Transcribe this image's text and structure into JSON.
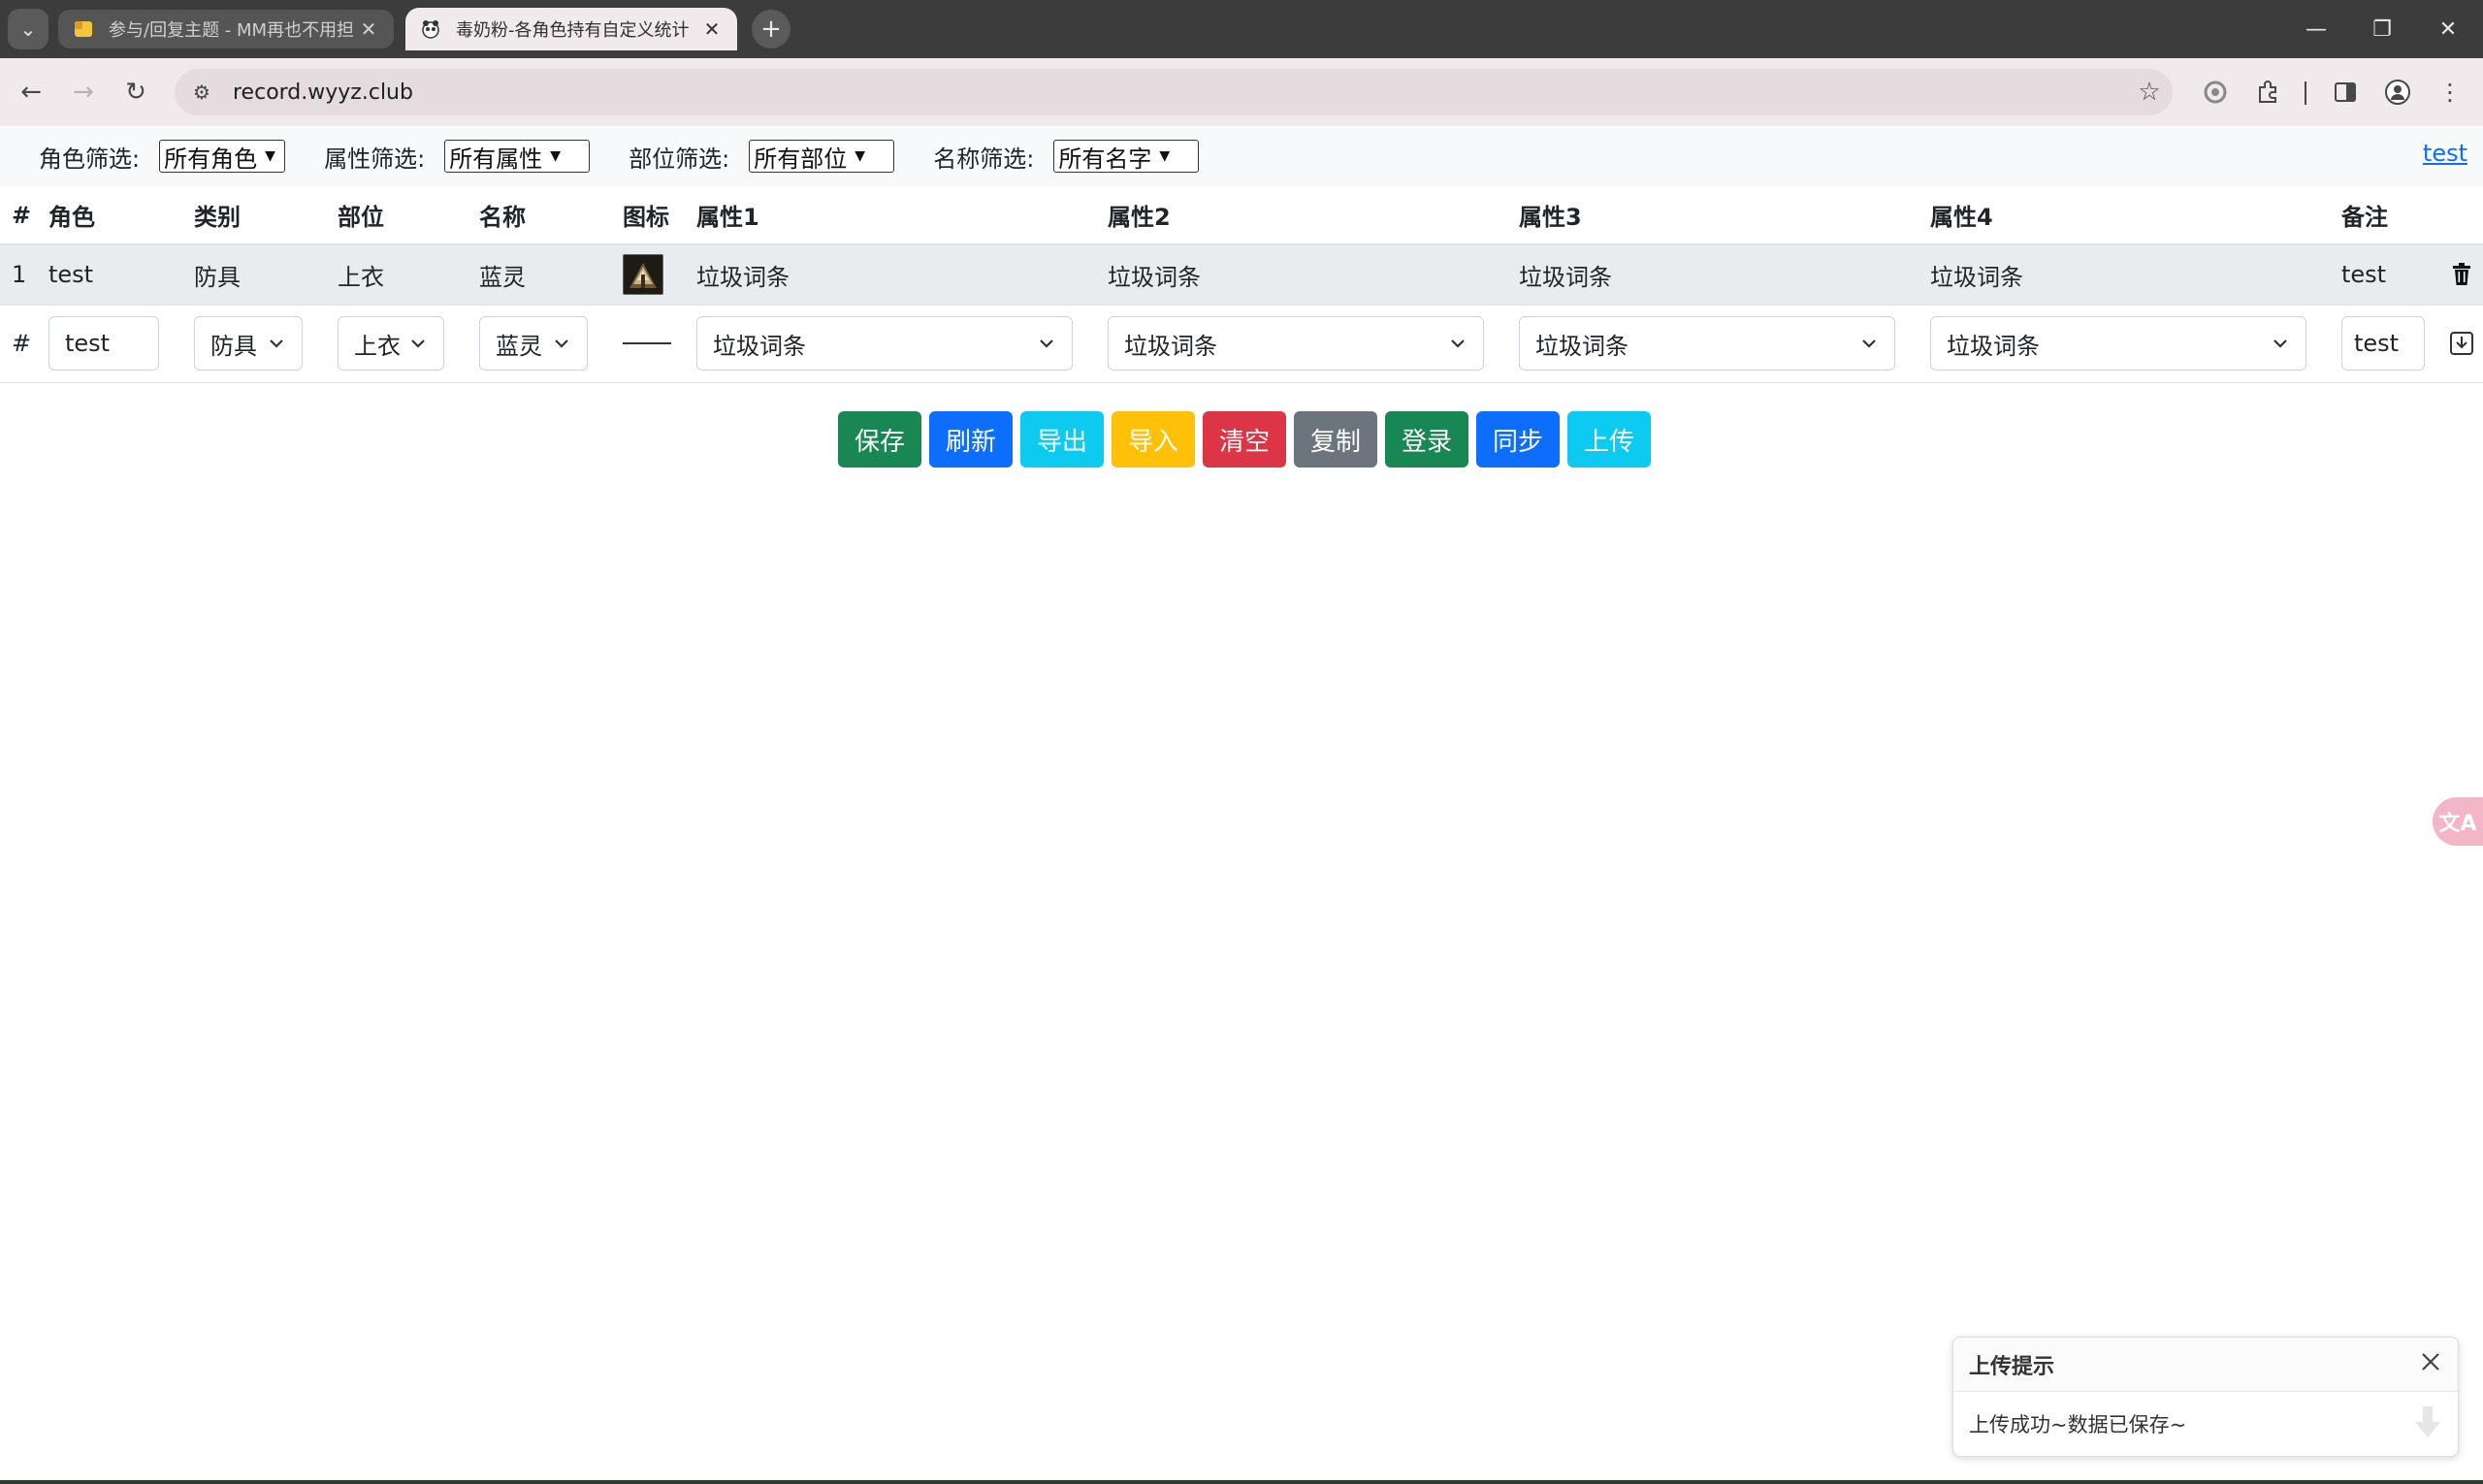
{
  "browser": {
    "tabs": [
      {
        "title": "参与/回复主题 - MM再也不用担",
        "active": false
      },
      {
        "title": "毒奶粉-各角色持有自定义统计",
        "active": true
      }
    ],
    "url": "record.wyyz.club",
    "icons": {
      "tab_search": "chevron-down-icon",
      "new_tab": "plus-icon",
      "back": "arrow-left-icon",
      "forward": "arrow-right-icon",
      "reload": "reload-icon",
      "site_info": "tune-icon",
      "bookmark": "star-icon"
    }
  },
  "filters": [
    {
      "label": "角色筛选:",
      "value": "所有角色"
    },
    {
      "label": "属性筛选:",
      "value": "所有属性"
    },
    {
      "label": "部位筛选:",
      "value": "所有部位"
    },
    {
      "label": "名称筛选:",
      "value": "所有名字"
    }
  ],
  "top_link": "test",
  "table": {
    "headers": [
      "#",
      "角色",
      "类别",
      "部位",
      "名称",
      "图标",
      "属性1",
      "属性2",
      "属性3",
      "属性4",
      "备注"
    ],
    "rows": [
      {
        "index": "1",
        "role": "test",
        "category": "防具",
        "slot": "上衣",
        "name": "蓝灵",
        "attr1": "垃圾词条",
        "attr2": "垃圾词条",
        "attr3": "垃圾词条",
        "attr4": "垃圾词条",
        "note": "test"
      }
    ],
    "edit_row": {
      "index": "#",
      "role": "test",
      "category": "防具",
      "slot": "上衣",
      "name": "蓝灵",
      "attr1": "垃圾词条",
      "attr2": "垃圾词条",
      "attr3": "垃圾词条",
      "attr4": "垃圾词条",
      "note": "test"
    }
  },
  "actions": [
    {
      "label": "保存",
      "color": "#198754"
    },
    {
      "label": "刷新",
      "color": "#0d6efd"
    },
    {
      "label": "导出",
      "color": "#0dcaf0"
    },
    {
      "label": "导入",
      "color": "#ffc107"
    },
    {
      "label": "清空",
      "color": "#dc3545"
    },
    {
      "label": "复制",
      "color": "#6c757d"
    },
    {
      "label": "登录",
      "color": "#198754"
    },
    {
      "label": "同步",
      "color": "#0d6efd"
    },
    {
      "label": "上传",
      "color": "#0dcaf0"
    }
  ],
  "toast": {
    "title": "上传提示",
    "message": "上传成功~数据已保存~"
  }
}
